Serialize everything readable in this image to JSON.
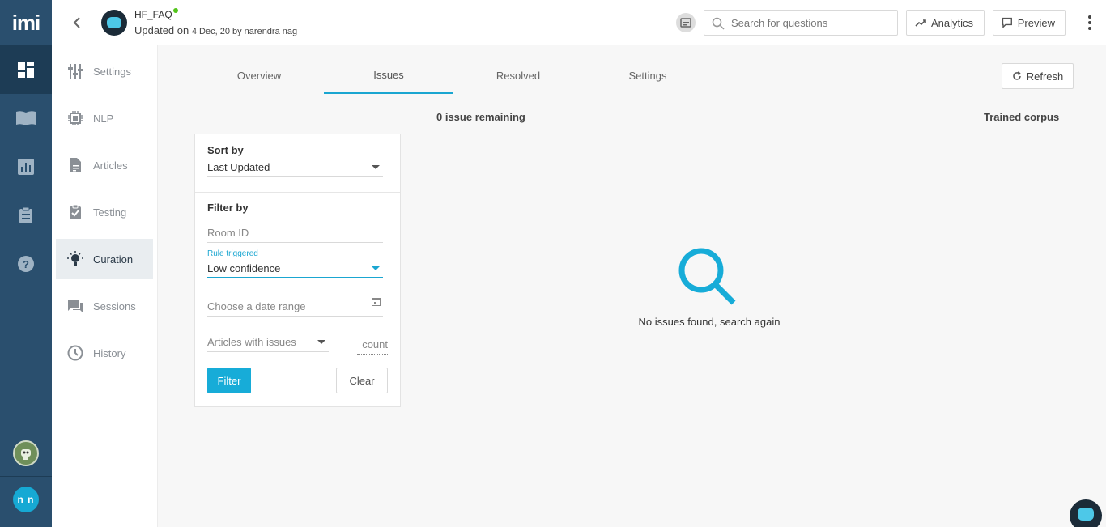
{
  "rail": {
    "logo": "imi",
    "items": [
      "dashboard-icon",
      "book-icon",
      "bar-chart-icon",
      "clipboard-icon",
      "help-icon"
    ],
    "user_initials": "n n"
  },
  "header": {
    "bot_name": "HF_FAQ",
    "updated_prefix": "Updated on",
    "updated_meta": "4 Dec, 20 by narendra nag",
    "search_placeholder": "Search for questions",
    "analytics_label": "Analytics",
    "preview_label": "Preview"
  },
  "sidebar": {
    "items": [
      {
        "label": "Settings",
        "icon": "sliders-icon"
      },
      {
        "label": "NLP",
        "icon": "chip-icon"
      },
      {
        "label": "Articles",
        "icon": "document-icon"
      },
      {
        "label": "Testing",
        "icon": "clipboard-check-icon"
      },
      {
        "label": "Curation",
        "icon": "lightbulb-icon",
        "active": true
      },
      {
        "label": "Sessions",
        "icon": "chat-icon"
      },
      {
        "label": "History",
        "icon": "history-icon"
      }
    ]
  },
  "tabs": [
    {
      "label": "Overview"
    },
    {
      "label": "Issues",
      "active": true
    },
    {
      "label": "Resolved"
    },
    {
      "label": "Settings"
    }
  ],
  "refresh_label": "Refresh",
  "issues_remaining": "0 issue remaining",
  "trained_corpus": "Trained corpus",
  "panel": {
    "sort_label": "Sort by",
    "sort_value": "Last Updated",
    "filter_label": "Filter by",
    "room_placeholder": "Room ID",
    "rule_label": "Rule triggered",
    "rule_value": "Low confidence",
    "date_placeholder": "Choose a date range",
    "articles_placeholder": "Articles with issues",
    "count_placeholder": "count",
    "filter_button": "Filter",
    "clear_button": "Clear"
  },
  "empty_state": "No issues found, search again",
  "colors": {
    "accent": "#1aa6d1",
    "rail": "#2a4f6e"
  }
}
